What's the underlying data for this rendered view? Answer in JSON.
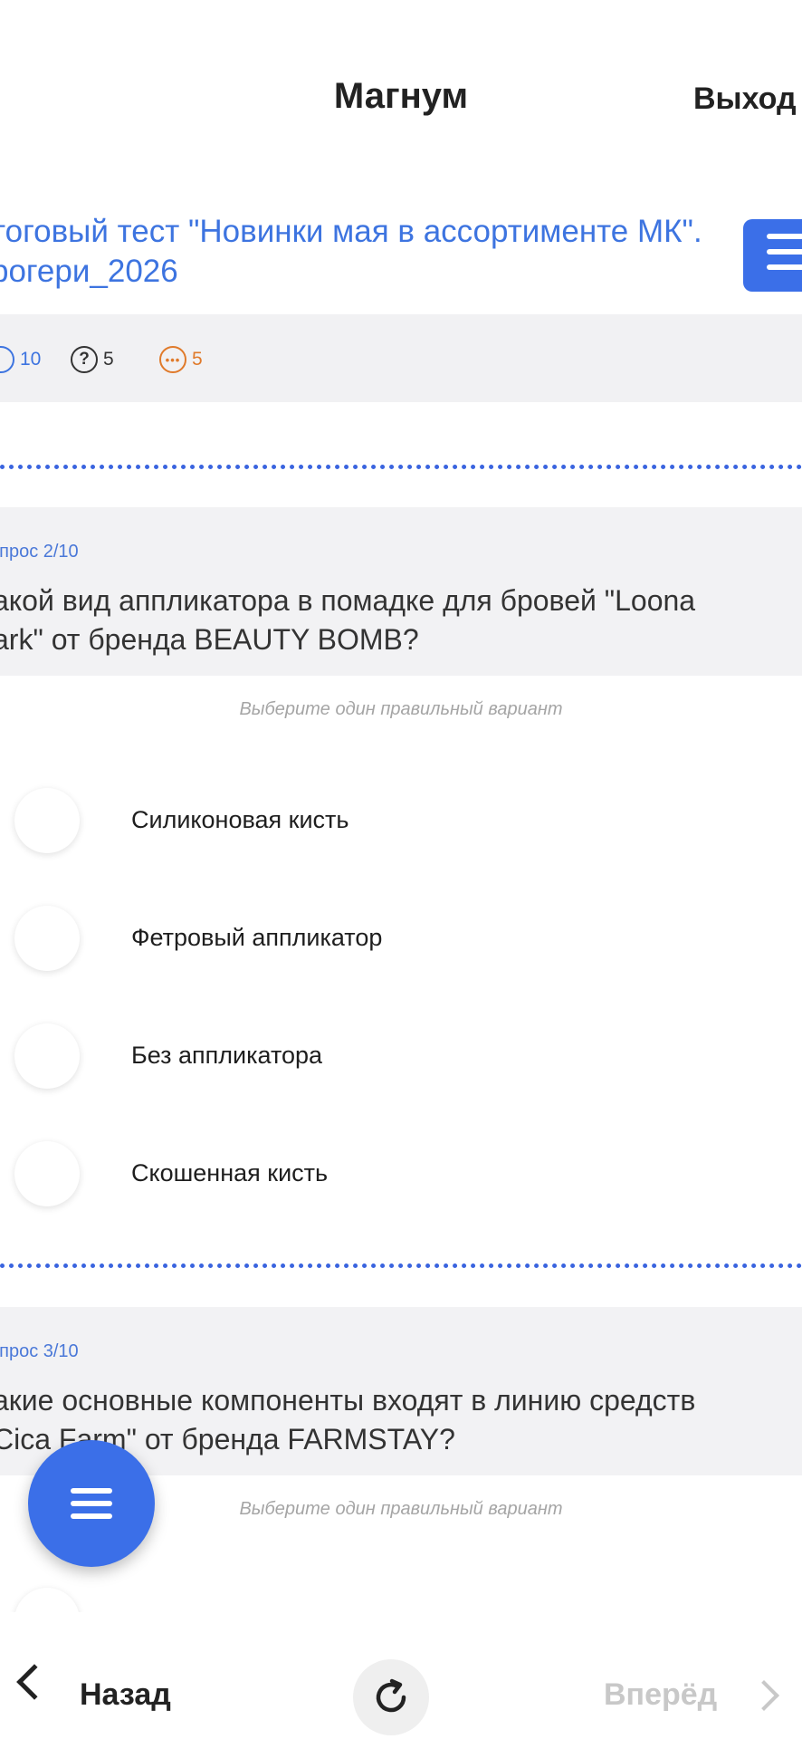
{
  "header": {
    "app_title": "Магнум",
    "logout_label": "Выход"
  },
  "test": {
    "title_line1": "тоговый тест \"Новинки мая в ассортименте МК\".",
    "title_line2": "рогери_2026"
  },
  "stats": {
    "questions_total": "10",
    "unanswered": "5",
    "pending": "5"
  },
  "questions": [
    {
      "number": "опрос 2/10",
      "text_line1": "акой вид аппликатора в помадке для бровей  \"Loona",
      "text_line2": "ark\" от бренда BEAUTY BOMB?",
      "hint": "Выберите один правильный вариант",
      "options": [
        "Силиконовая кисть",
        "Фетровый аппликатор",
        "Без аппликатора",
        "Скошенная кисть"
      ]
    },
    {
      "number": "опрос 3/10",
      "text_line1": "акие основные компоненты входят в линию средств",
      "text_line2": "Cica Farm\" от бренда FARMSTAY?",
      "hint": "Выберите один правильный вариант"
    }
  ],
  "bottom_nav": {
    "back_label": "Назад",
    "forward_label": "Вперёд"
  },
  "colors": {
    "accent": "#3b6fe8",
    "link": "#3d74e0",
    "orange": "#e07a2a",
    "disabled": "#c8c8c8"
  }
}
